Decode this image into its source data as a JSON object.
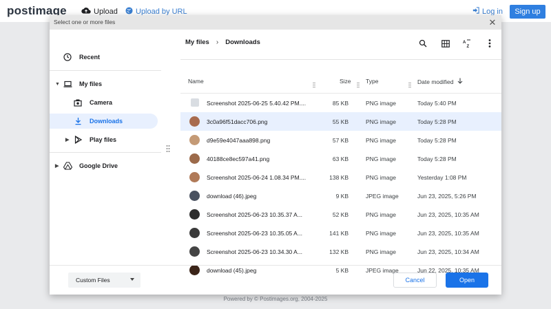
{
  "site": {
    "logo": "postimage",
    "upload_label": "Upload",
    "upload_url_label": "Upload by URL",
    "login_label": "Log in",
    "signup_label": "Sign up",
    "footer": "Powered by © Postimages.org, 2004-2025"
  },
  "dialog": {
    "title": "Select one or more files",
    "close_icon": "close-icon"
  },
  "sidebar": {
    "recent": "Recent",
    "my_files": "My files",
    "camera": "Camera",
    "downloads": "Downloads",
    "play_files": "Play files",
    "google_drive": "Google Drive"
  },
  "breadcrumb": {
    "root": "My files",
    "current": "Downloads"
  },
  "columns": {
    "name": "Name",
    "size": "Size",
    "type": "Type",
    "date": "Date modified"
  },
  "files": [
    {
      "name": "Screenshot 2025-06-25 5.40.42 PM....",
      "size": "85 KB",
      "type": "PNG image",
      "date": "Today 5:40 PM",
      "selected": false,
      "thumb": "#d9dde2"
    },
    {
      "name": "3c0a96f51dacc706.png",
      "size": "55 KB",
      "type": "PNG image",
      "date": "Today 5:28 PM",
      "selected": true,
      "thumb": "#a86b4e"
    },
    {
      "name": "d9e59e4047aaa898.png",
      "size": "57 KB",
      "type": "PNG image",
      "date": "Today 5:28 PM",
      "selected": false,
      "thumb": "#c49a76"
    },
    {
      "name": "40188ce8ec597a41.png",
      "size": "63 KB",
      "type": "PNG image",
      "date": "Today 5:28 PM",
      "selected": false,
      "thumb": "#9c6a4a"
    },
    {
      "name": "Screenshot 2025-06-24 1.08.34 PM....",
      "size": "138 KB",
      "type": "PNG image",
      "date": "Yesterday 1:08 PM",
      "selected": false,
      "thumb": "#b07a58"
    },
    {
      "name": "download (46).jpeg",
      "size": "9 KB",
      "type": "JPEG image",
      "date": "Jun 23, 2025, 5:26 PM",
      "selected": false,
      "thumb": "#4a5260"
    },
    {
      "name": "Screenshot 2025-06-23 10.35.37 A...",
      "size": "52 KB",
      "type": "PNG image",
      "date": "Jun 23, 2025, 10:35 AM",
      "selected": false,
      "thumb": "#2d2d2d"
    },
    {
      "name": "Screenshot 2025-06-23 10.35.05 A...",
      "size": "141 KB",
      "type": "PNG image",
      "date": "Jun 23, 2025, 10:35 AM",
      "selected": false,
      "thumb": "#3a3a3a"
    },
    {
      "name": "Screenshot 2025-06-23 10.34.30 A...",
      "size": "132 KB",
      "type": "PNG image",
      "date": "Jun 23, 2025, 10:34 AM",
      "selected": false,
      "thumb": "#444444"
    },
    {
      "name": "download (45).jpeg",
      "size": "5 KB",
      "type": "JPEG image",
      "date": "Jun 22, 2025, 10:35 AM",
      "selected": false,
      "thumb": "#3b2418"
    }
  ],
  "footer": {
    "filter_value": "Custom Files",
    "cancel_label": "Cancel",
    "open_label": "Open"
  },
  "colors": {
    "accent": "#1a73e8",
    "selected_row": "#e8f0fe",
    "signup": "#2f7fe0"
  }
}
